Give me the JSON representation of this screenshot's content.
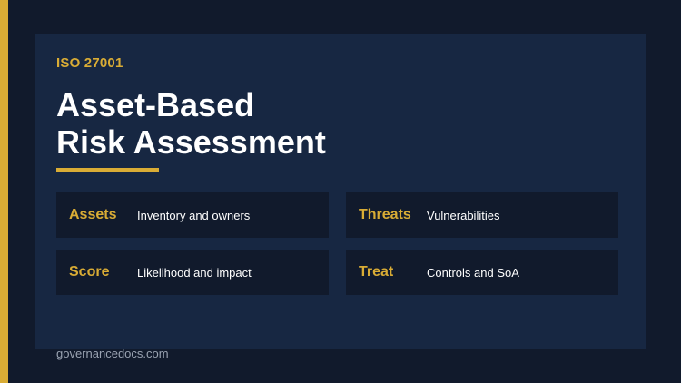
{
  "header": {
    "eyebrow": "ISO 27001",
    "title_line1": "Asset-Based",
    "title_line2": "Risk Assessment"
  },
  "cards": [
    {
      "key": "Assets",
      "desc": "Inventory and owners"
    },
    {
      "key": "Threats",
      "desc": "Vulnerabilities"
    },
    {
      "key": "Score",
      "desc": "Likelihood and impact"
    },
    {
      "key": "Treat",
      "desc": "Controls and SoA"
    }
  ],
  "footer": {
    "site": "governancedocs.com"
  },
  "colors": {
    "background": "#111a2c",
    "panel": "#172742",
    "accent": "#d9ac35",
    "text": "#ffffff"
  }
}
